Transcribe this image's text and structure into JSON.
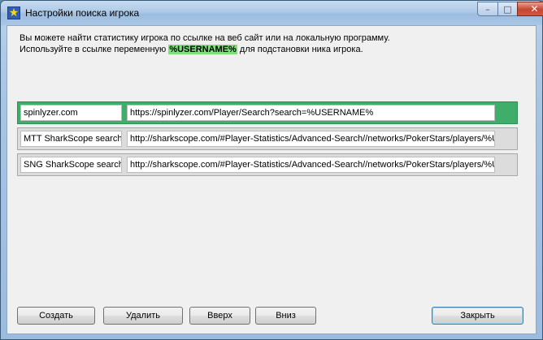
{
  "window": {
    "title": "Настройки поиска игрока",
    "controls": {
      "minimize": "–",
      "maximize": "□",
      "close": "✕"
    }
  },
  "description": {
    "line1": "Вы можете найти статистику игрока по ссылке на веб сайт или на локальную программу.",
    "line2_before": "Используйте в ссылке переменную ",
    "variable": "%USERNAME%",
    "line2_after": " для подстановки ника игрока."
  },
  "entries": [
    {
      "name": "spinlyzer.com",
      "url": "https://spinlyzer.com/Player/Search?search=%USERNAME%",
      "selected": true
    },
    {
      "name": "MTT SharkScope search",
      "url": "http://sharkscope.com/#Player-Statistics/Advanced-Search//networks/PokerStars/players/%U",
      "selected": false
    },
    {
      "name": "SNG SharkScope search",
      "url": "http://sharkscope.com/#Player-Statistics/Advanced-Search//networks/PokerStars/players/%U",
      "selected": false
    }
  ],
  "buttons": {
    "create": "Создать",
    "delete": "Удалить",
    "up": "Вверх",
    "down": "Вниз",
    "close": "Закрыть"
  },
  "colors": {
    "selected_row": "#3fae6b",
    "variable_highlight": "#7ee07a"
  }
}
